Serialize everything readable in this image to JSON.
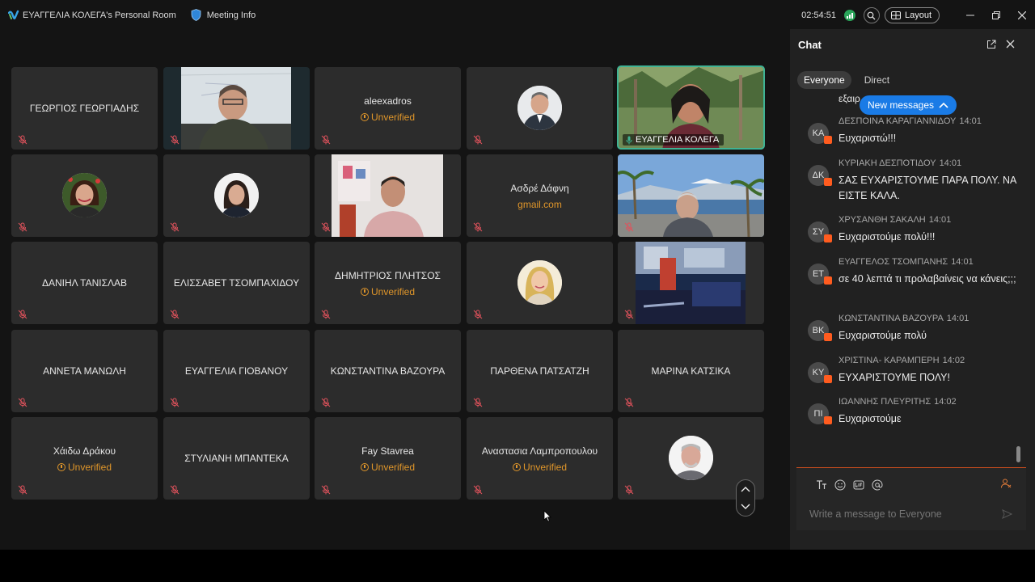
{
  "titlebar": {
    "room_title": "ΕΥΑΓΓΕΛΙΑ ΚΟΛΕΓΑ's Personal Room",
    "meeting_info": "Meeting Info",
    "time": "02:54:51",
    "layout_label": "Layout"
  },
  "participants": [
    {
      "name": "ΓΕΩΡΓΙΟΣ ΓΕΩΡΓΙΑΔΗΣ",
      "status": "",
      "kind": "name"
    },
    {
      "name": "",
      "status": "",
      "kind": "video"
    },
    {
      "name": "aleexadros",
      "status": "Unverified",
      "kind": "name"
    },
    {
      "name": "",
      "status": "",
      "kind": "avatar"
    },
    {
      "name": "ΕΥΑΓΓΕΛΙΑ ΚΟΛΕΓΑ",
      "status": "",
      "kind": "self-video"
    },
    {
      "name": "",
      "status": "",
      "kind": "avatar"
    },
    {
      "name": "",
      "status": "",
      "kind": "avatar"
    },
    {
      "name": "",
      "status": "",
      "kind": "video"
    },
    {
      "name": "Ασδρέ Δάφνη",
      "status": "gmail.com",
      "kind": "name"
    },
    {
      "name": "",
      "status": "",
      "kind": "video"
    },
    {
      "name": "ΔΑΝΙΗΛ ΤΑΝΙΣΛΑΒ",
      "status": "",
      "kind": "name"
    },
    {
      "name": "ΕΛΙΣΣΑΒΕΤ ΤΣΟΜΠΑΧΙΔΟΥ",
      "status": "",
      "kind": "name"
    },
    {
      "name": "ΔΗΜΗΤΡΙΟΣ ΠΛΗΤΣΟΣ",
      "status": "Unverified",
      "kind": "name"
    },
    {
      "name": "",
      "status": "",
      "kind": "avatar"
    },
    {
      "name": "",
      "status": "",
      "kind": "video"
    },
    {
      "name": "ΑΝΝΕΤΑ ΜΑΝΩΛΗ",
      "status": "",
      "kind": "name"
    },
    {
      "name": "ΕΥΑΓΓΕΛΙΑ ΓΙΟΒΑΝΟΥ",
      "status": "",
      "kind": "name"
    },
    {
      "name": "ΚΩΝΣΤΑΝΤΙΝΑ ΒΑΖΟΥΡΑ",
      "status": "",
      "kind": "name"
    },
    {
      "name": "ΠΑΡΘΕΝΑ ΠΑΤΣΑΤΖΗ",
      "status": "",
      "kind": "name"
    },
    {
      "name": "ΜΑΡΙΝΑ ΚΑΤΣΙΚΑ",
      "status": "",
      "kind": "name"
    },
    {
      "name": "Χάιδω Δράκου",
      "status": "Unverified",
      "kind": "name"
    },
    {
      "name": "ΣΤΥΛΙΑΝΗ ΜΠΑΝΤΕΚΑ",
      "status": "",
      "kind": "name"
    },
    {
      "name": "Fay Stavrea",
      "status": "Unverified",
      "kind": "name"
    },
    {
      "name": "Αναστασια Λαμπροπουλου",
      "status": "Unverified",
      "kind": "name"
    },
    {
      "name": "",
      "status": "",
      "kind": "avatar"
    }
  ],
  "chat": {
    "title": "Chat",
    "tabs": [
      "Everyone",
      "Direct"
    ],
    "partial_text": "εξαιρ",
    "new_messages": "New messages",
    "messages": [
      {
        "initials": "ΚΑ",
        "sender": "ΔΕΣΠΟΙΝΑ ΚΑΡΑΓΙΑΝΝΙΔΟΥ",
        "time": "14:01",
        "text": "Ευχαριστώ!!!"
      },
      {
        "initials": "ΔΚ",
        "sender": "ΚΥΡΙΑΚΗ ΔΕΣΠΟΤΙΔΟΥ",
        "time": "14:01",
        "text": "ΣΑΣ ΕΥΧΑΡΙΣΤΟΥΜΕ ΠΑΡΑ ΠΟΛΥ. ΝΑ ΕΙΣΤΕ ΚΑΛΑ."
      },
      {
        "initials": "ΣΥ",
        "sender": "ΧΡΥΣΑΝΘΗ ΣΑΚΑΛΗ",
        "time": "14:01",
        "text": "Ευχαριστούμε πολύ!!!"
      },
      {
        "initials": "ΕΤ",
        "sender": "ΕΥΑΓΓΕΛΟΣ ΤΣΟΜΠΑΝΗΣ",
        "time": "14:01",
        "text": "σε 40 λεπτά τι προλαβαίνεις να κάνεις;;;"
      },
      {
        "initials": "ΒΚ",
        "sender": "ΚΩΝΣΤΑΝΤΙΝΑ ΒΑΖΟΥΡΑ",
        "time": "14:01",
        "text": "Ευχαριστούμε πολύ"
      },
      {
        "initials": "ΚΥ",
        "sender": "ΧΡΙΣΤΙΝΑ- ΚΑΡΑΜΠΕΡΗ",
        "time": "14:02",
        "text": "ΕΥΧΑΡΙΣΤΟΥΜΕ ΠΟΛΥ!"
      },
      {
        "initials": "ΠΙ",
        "sender": "ΙΩΑΝΝΗΣ ΠΛΕΥΡΙΤΗΣ",
        "time": "14:02",
        "text": "Ευχαριστούμε"
      }
    ],
    "composer_placeholder": "Write a message to Everyone"
  },
  "colors": {
    "unverified": "#e0962a",
    "active_speaker": "#3fb394",
    "new_messages": "#1a7be6",
    "mute_icon": "#e0525c"
  }
}
